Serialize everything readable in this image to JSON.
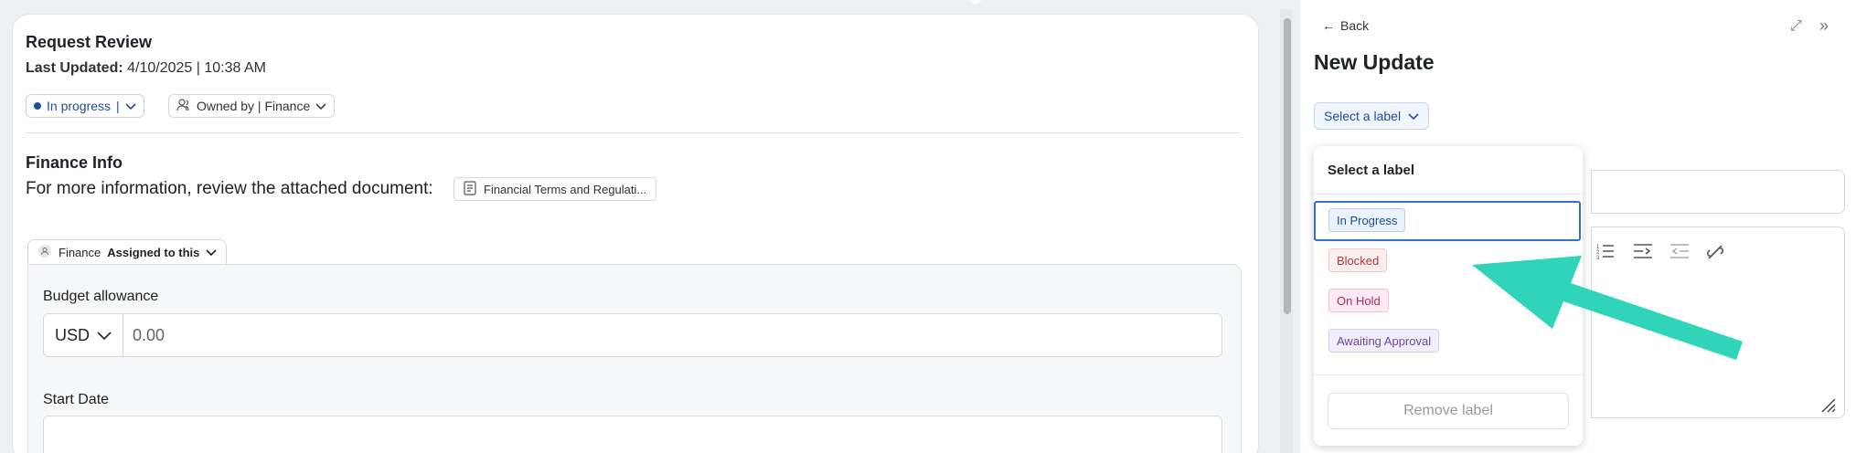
{
  "request": {
    "title": "Request Review",
    "updated_label": "Last Updated:",
    "updated_value": " 4/10/2025 | 10:38 AM",
    "status": "In progress",
    "status_sep": "|",
    "owner": "Owned by | Finance"
  },
  "finance": {
    "heading": "Finance Info",
    "info_text": "For more information, review the attached document:",
    "doc_name": "Financial Terms and Regulati...",
    "assign_team": "Finance",
    "assign_text": "Assigned to this",
    "budget_label": "Budget allowance",
    "currency": "USD",
    "amount_placeholder": "0.00",
    "start_label": "Start Date"
  },
  "panel": {
    "back": "Back",
    "title": "New Update",
    "label_button": "Select a label"
  },
  "dropdown": {
    "title": "Select a label",
    "options": [
      "In Progress",
      "Blocked",
      "On Hold",
      "Awaiting Approval"
    ],
    "selected": "In Progress",
    "remove": "Remove label"
  },
  "colors": {
    "accent": "#1d4f9c",
    "arrow": "#2fd4b9"
  }
}
